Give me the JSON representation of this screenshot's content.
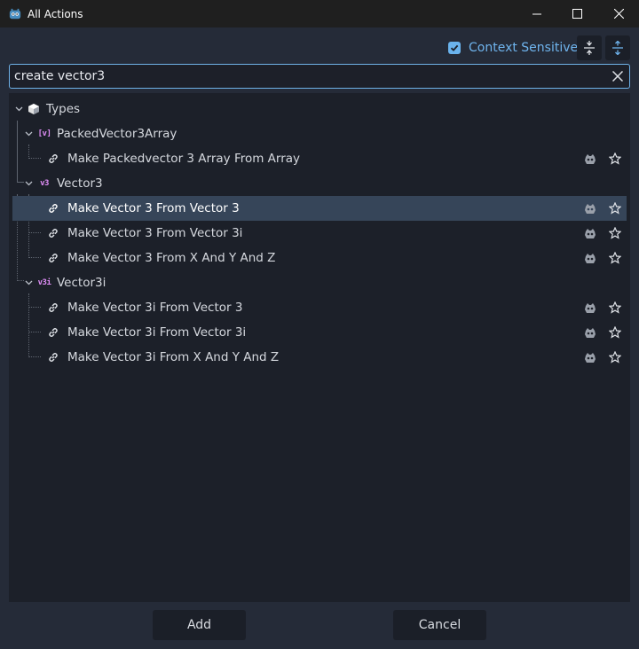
{
  "window": {
    "title": "All Actions",
    "icon": "godot-engine-icon",
    "controls": [
      "minimize-icon",
      "maximize-icon",
      "close-icon"
    ]
  },
  "toolbar": {
    "context_sensitive_label": "Context Sensitive",
    "context_sensitive_checked": true,
    "collapse_icon": "collapse-all-icon",
    "expand_icon": "expand-all-icon"
  },
  "search": {
    "value": "create vector3",
    "clear_icon": "clear-icon"
  },
  "tree": {
    "root": {
      "label": "Types",
      "icon": "cube-icon",
      "expanded": true
    },
    "groups": [
      {
        "label": "PackedVector3Array",
        "icon": "packed-vector3-array-icon",
        "badge": "[v]",
        "expanded": true,
        "items": [
          {
            "label": "Make Packedvector 3 Array From Array",
            "icon": "link-icon",
            "selected": false
          }
        ]
      },
      {
        "label": "Vector3",
        "icon": "vector3-icon",
        "badge": "v3",
        "expanded": true,
        "items": [
          {
            "label": "Make Vector 3 From Vector 3",
            "icon": "link-icon",
            "selected": true
          },
          {
            "label": "Make Vector 3 From Vector 3i",
            "icon": "link-icon",
            "selected": false
          },
          {
            "label": "Make Vector 3 From X And Y And Z",
            "icon": "link-icon",
            "selected": false
          }
        ]
      },
      {
        "label": "Vector3i",
        "icon": "vector3i-icon",
        "badge": "v3i",
        "expanded": true,
        "items": [
          {
            "label": "Make Vector 3i From Vector 3",
            "icon": "link-icon",
            "selected": false
          },
          {
            "label": "Make Vector 3i From Vector 3i",
            "icon": "link-icon",
            "selected": false
          },
          {
            "label": "Make Vector 3i From X And Y And Z",
            "icon": "link-icon",
            "selected": false
          }
        ]
      }
    ],
    "row_action_icons": [
      "godot-engine-icon",
      "favorite-star-icon"
    ]
  },
  "footer": {
    "add_label": "Add",
    "cancel_label": "Cancel"
  },
  "colors": {
    "accent": "#6fb4ee",
    "selection": "#364559",
    "background": "#252b38",
    "tree_background": "#1c2029",
    "type_badge": "#e08ef7"
  }
}
